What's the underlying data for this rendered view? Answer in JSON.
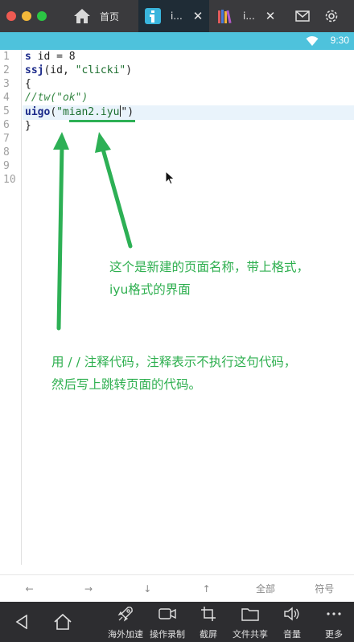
{
  "window": {
    "tabs": [
      {
        "label": "首页",
        "icon": "home-icon"
      },
      {
        "label": "i...",
        "icon": "app-i-icon"
      },
      {
        "label": "i...",
        "icon": "books-icon"
      }
    ]
  },
  "statusbar": {
    "time": "9:30"
  },
  "editor": {
    "line_numbers": [
      "1",
      "2",
      "3",
      "4",
      "5",
      "6",
      "7",
      "8",
      "9",
      "10"
    ],
    "lines": [
      {
        "kw": "s",
        "rest": " id = 8"
      },
      {
        "kw": "ssj",
        "rest": "(id, ",
        "str": "\"clicki\"",
        "tail": ")"
      },
      {
        "plain": "{"
      },
      {
        "comment": "//tw(\"ok\")"
      },
      {
        "kw": "uigo",
        "rest": "(",
        "str": "\"mian2.iyu",
        "tail": "\")"
      },
      {
        "plain": "}"
      }
    ]
  },
  "annotations": {
    "note1_line1": "这个是新建的页面名称，带上格式，",
    "note1_line2": "iyu格式的界面",
    "note2_line1": "用 / / 注释代码，注释表示不执行这句代码，",
    "note2_line2": "然后写上跳转页面的代码。"
  },
  "shortcuts": [
    "←",
    "→",
    "↓",
    "↑",
    "全部",
    "符号"
  ],
  "nav": {
    "accelerate": "海外加速",
    "record": "操作录制",
    "screenshot": "截屏",
    "file_share": "文件共享",
    "volume": "音量",
    "more": "更多"
  },
  "colors": {
    "annotation_green": "#2eaf4f",
    "status_bar": "#4ec2dc",
    "title_bar": "#3a3a3d",
    "nav_bar": "#2d2d30"
  }
}
